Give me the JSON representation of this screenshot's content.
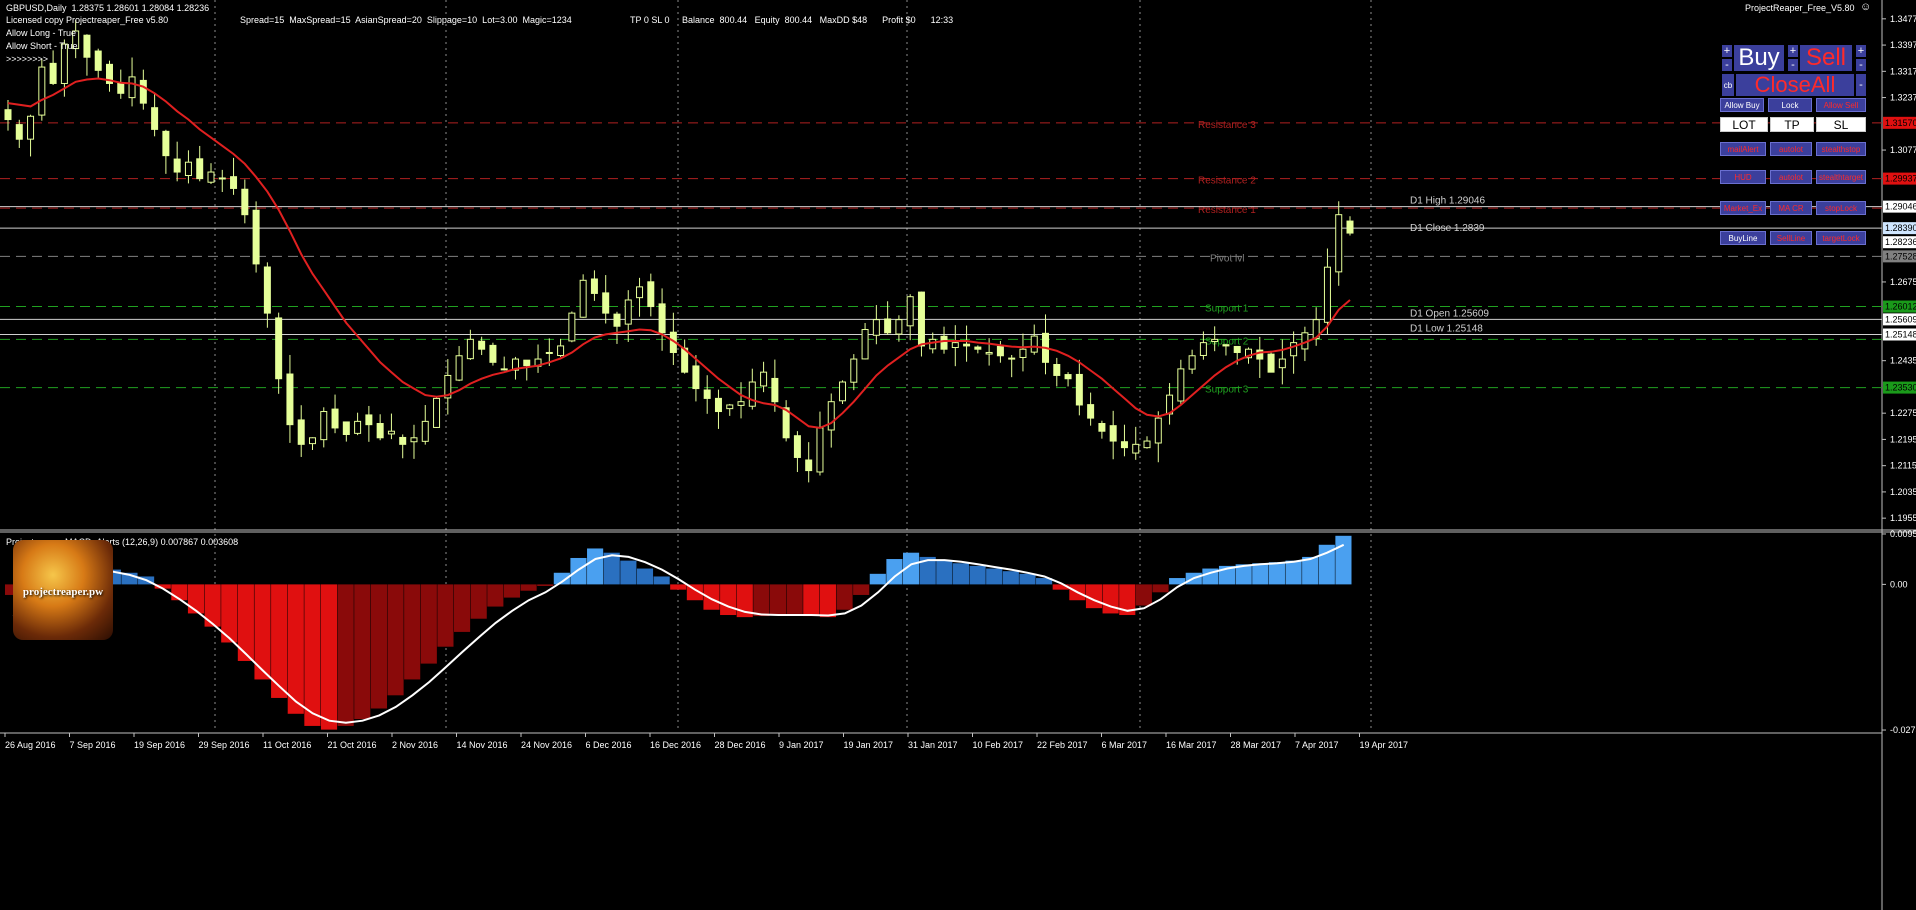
{
  "header": {
    "symbol_line": "GBPUSD,Daily  1.28375 1.28601 1.28084 1.28236",
    "license": "Licensed copy Projectreaper_Free v5.80",
    "allow_long": "Allow Long - True",
    "allow_short": "Allow Short - True",
    "arrows": ">>>>>>>>",
    "stats": "Spread=15  MaxSpread=15  AsianSpread=20  Slippage=10  Lot=3.00  Magic=1234",
    "account": "TP 0 SL 0     Balance  800.44   Equity  800.44   MaxDD $48      Profit $0      12:33",
    "ea_name": "ProjectReaper_Free_V5.80",
    "smiley": "☺"
  },
  "panel": {
    "buy": "Buy",
    "sell": "Sell",
    "close_all": "CloseAll",
    "plus": "+",
    "minus": "-",
    "cb": "cb",
    "allow_buy": "Allow Buy",
    "lock": "Lock",
    "allow_sell": "Allow Sell",
    "lot": "LOT",
    "tp": "TP",
    "sl": "SL",
    "row1": [
      "mailAlert",
      "autolot",
      "stealthstop"
    ],
    "row2": [
      "HUD",
      "autolot",
      "stealthtarget"
    ],
    "row3": [
      "Market_Ex",
      "MA CR",
      "stopLock"
    ],
    "row4": [
      "BuyLine",
      "SellLine",
      "targetLock"
    ]
  },
  "logo_text": "projectreaper.pw",
  "colors": {
    "bull_candle": "#e6ff99",
    "ma_line": "#e02020",
    "resistance": "#b02020",
    "support": "#20a020",
    "pivot": "#808080",
    "hist_positive": "#4aa0f0",
    "hist_negative": "#e01010",
    "signal": "#ffffff"
  },
  "chart_data": [
    {
      "type": "candlestick",
      "symbol": "GBPUSD",
      "timeframe": "Daily",
      "ylim": [
        1.1925,
        1.351
      ],
      "y_ticks": [
        "1.34770",
        "1.33970",
        "1.33170",
        "1.32370",
        "1.31570",
        "1.30770",
        "1.29970",
        "1.29046",
        "1.28390",
        "1.28236",
        "1.27528",
        "1.26750",
        "1.25609",
        "1.25148",
        "1.24350",
        "1.23530",
        "1.22750",
        "1.21950",
        "1.21150",
        "1.20350",
        "1.19550"
      ],
      "x_ticks": [
        "26 Aug 2016",
        "7 Sep 2016",
        "19 Sep 2016",
        "29 Sep 2016",
        "11 Oct 2016",
        "21 Oct 2016",
        "2 Nov 2016",
        "14 Nov 2016",
        "24 Nov 2016",
        "6 Dec 2016",
        "16 Dec 2016",
        "28 Dec 2016",
        "9 Jan 2017",
        "19 Jan 2017",
        "31 Jan 2017",
        "10 Feb 2017",
        "22 Feb 2017",
        "6 Mar 2017",
        "16 Mar 2017",
        "28 Mar 2017",
        "7 Apr 2017",
        "19 Apr 2017"
      ],
      "close_series": [
        1.317,
        1.311,
        1.318,
        1.333,
        1.328,
        1.34,
        1.344,
        1.336,
        1.332,
        1.328,
        1.325,
        1.33,
        1.322,
        1.314,
        1.306,
        1.301,
        1.304,
        1.299,
        1.301,
        1.299,
        1.296,
        1.288,
        1.273,
        1.258,
        1.238,
        1.224,
        1.218,
        1.22,
        1.228,
        1.223,
        1.221,
        1.225,
        1.224,
        1.22,
        1.222,
        1.218,
        1.22,
        1.225,
        1.232,
        1.239,
        1.245,
        1.25,
        1.247,
        1.243,
        1.241,
        1.244,
        1.242,
        1.244,
        1.246,
        1.248,
        1.258,
        1.268,
        1.264,
        1.258,
        1.254,
        1.262,
        1.266,
        1.26,
        1.252,
        1.246,
        1.24,
        1.235,
        1.232,
        1.228,
        1.23,
        1.231,
        1.237,
        1.24,
        1.231,
        1.22,
        1.214,
        1.21,
        1.223,
        1.231,
        1.237,
        1.244,
        1.253,
        1.256,
        1.252,
        1.256,
        1.263,
        1.248,
        1.25,
        1.247,
        1.249,
        1.248,
        1.247,
        1.246,
        1.245,
        1.244,
        1.247,
        1.251,
        1.243,
        1.239,
        1.238,
        1.23,
        1.226,
        1.222,
        1.219,
        1.217,
        1.218,
        1.219,
        1.226,
        1.233,
        1.241,
        1.245,
        1.249,
        1.25,
        1.248,
        1.246,
        1.247,
        1.244,
        1.24,
        1.244,
        1.249,
        1.252,
        1.256,
        1.272,
        1.288,
        1.2824
      ],
      "ma_series": [
        1.322,
        1.3215,
        1.321,
        1.323,
        1.3245,
        1.3265,
        1.3285,
        1.3292,
        1.3295,
        1.329,
        1.3282,
        1.328,
        1.327,
        1.325,
        1.3225,
        1.3195,
        1.317,
        1.314,
        1.3115,
        1.309,
        1.3065,
        1.3035,
        1.2995,
        1.295,
        1.2895,
        1.283,
        1.276,
        1.27,
        1.265,
        1.26,
        1.255,
        1.251,
        1.247,
        1.243,
        1.24,
        1.237,
        1.235,
        1.233,
        1.2325,
        1.233,
        1.2345,
        1.2365,
        1.238,
        1.2392,
        1.24,
        1.241,
        1.2415,
        1.242,
        1.243,
        1.2442,
        1.246,
        1.2485,
        1.2505,
        1.2515,
        1.252,
        1.2525,
        1.253,
        1.2528,
        1.2515,
        1.2495,
        1.247,
        1.244,
        1.241,
        1.238,
        1.2355,
        1.233,
        1.2315,
        1.2305,
        1.23,
        1.2285,
        1.226,
        1.2235,
        1.223,
        1.2245,
        1.2275,
        1.231,
        1.235,
        1.239,
        1.242,
        1.2445,
        1.247,
        1.2485,
        1.249,
        1.2495,
        1.2495,
        1.2495,
        1.249,
        1.2487,
        1.2482,
        1.2478,
        1.2476,
        1.2478,
        1.2474,
        1.2465,
        1.245,
        1.243,
        1.2405,
        1.238,
        1.235,
        1.232,
        1.229,
        1.227,
        1.2265,
        1.2275,
        1.23,
        1.233,
        1.236,
        1.239,
        1.2415,
        1.2435,
        1.245,
        1.246,
        1.2462,
        1.2468,
        1.2478,
        1.249,
        1.2505,
        1.254,
        1.259,
        1.262
      ],
      "levels": [
        {
          "label": "Resistance 3",
          "value": 1.316,
          "kind": "resistance",
          "price_label": "1.31570"
        },
        {
          "label": "Resistance 2",
          "value": 1.299,
          "kind": "resistance",
          "price_label": "1.29937"
        },
        {
          "label": "Resistance 1",
          "value": 1.29,
          "kind": "resistance",
          "price_label": ""
        },
        {
          "label": "Pivot lvl",
          "value": 1.2753,
          "kind": "pivot",
          "price_label": "1.27528"
        },
        {
          "label": "Support 1",
          "value": 1.26,
          "kind": "support",
          "price_label": "1.26012"
        },
        {
          "label": "Support 2",
          "value": 1.25,
          "kind": "support",
          "price_label": ""
        },
        {
          "label": "Support 3",
          "value": 1.2353,
          "kind": "support",
          "price_label": "1.23530"
        }
      ],
      "day_lines": [
        {
          "label": "D1 High  1.29046",
          "value": 1.29046
        },
        {
          "label": "D1 Close  1.2839",
          "value": 1.2839
        },
        {
          "label": "D1 Open  1.25609",
          "value": 1.25609
        },
        {
          "label": "D1 Low  1.25148",
          "value": 1.25148
        }
      ]
    },
    {
      "type": "bar",
      "title": "Projectreaper_MACD_Alerts (12,26,9)  0.007867  0.003608",
      "ylim": [
        -0.02757,
        0.00954
      ],
      "y_ticks": [
        "0.009545",
        "0.00",
        "-0.027576"
      ],
      "histogram": [
        -0.002,
        -0.0015,
        0.001,
        0.0022,
        0.0028,
        0.003,
        0.0028,
        0.0022,
        0.0015,
        -0.0008,
        -0.003,
        -0.0055,
        -0.008,
        -0.011,
        -0.0145,
        -0.018,
        -0.0215,
        -0.0245,
        -0.0268,
        -0.0275,
        -0.0268,
        -0.0255,
        -0.0235,
        -0.021,
        -0.018,
        -0.015,
        -0.0118,
        -0.009,
        -0.0065,
        -0.0042,
        -0.0025,
        -0.0012,
        -0.0003,
        0.0022,
        0.005,
        0.0068,
        0.006,
        0.0045,
        0.003,
        0.0015,
        -0.001,
        -0.003,
        -0.0048,
        -0.0058,
        -0.0062,
        -0.006,
        -0.0058,
        -0.0056,
        -0.006,
        -0.0062,
        -0.0048,
        -0.002,
        0.002,
        0.0048,
        0.006,
        0.0052,
        0.0045,
        0.004,
        0.0035,
        0.003,
        0.0025,
        0.002,
        0.0012,
        -0.001,
        -0.003,
        -0.0045,
        -0.0055,
        -0.0058,
        -0.004,
        -0.0015,
        0.0012,
        0.0022,
        0.003,
        0.0035,
        0.0038,
        0.004,
        0.0042,
        0.0045,
        0.0052,
        0.0075,
        0.0092
      ],
      "signal": [
        -0.006,
        -0.004,
        -0.0015,
        0.0005,
        0.0018,
        0.0024,
        0.0024,
        0.0018,
        0.0008,
        -0.0008,
        -0.0028,
        -0.005,
        -0.0075,
        -0.0102,
        -0.0132,
        -0.0163,
        -0.0193,
        -0.0222,
        -0.0244,
        -0.0258,
        -0.0262,
        -0.0258,
        -0.0248,
        -0.0232,
        -0.021,
        -0.0185,
        -0.0157,
        -0.0128,
        -0.01,
        -0.0073,
        -0.005,
        -0.003,
        -0.0015,
        0.0005,
        0.0028,
        0.0048,
        0.0055,
        0.0052,
        0.0042,
        0.0028,
        0.001,
        -0.001,
        -0.0028,
        -0.0042,
        -0.0052,
        -0.0057,
        -0.0058,
        -0.0058,
        -0.0058,
        -0.0059,
        -0.0055,
        -0.004,
        -0.0015,
        0.0015,
        0.0038,
        0.0046,
        0.0046,
        0.0043,
        0.0038,
        0.0033,
        0.0028,
        0.0022,
        0.0015,
        0.0002,
        -0.0015,
        -0.003,
        -0.0042,
        -0.005,
        -0.0045,
        -0.0028,
        -0.0005,
        0.0012,
        0.0022,
        0.003,
        0.0035,
        0.0038,
        0.004,
        0.0043,
        0.0048,
        0.006,
        0.0075
      ]
    }
  ]
}
